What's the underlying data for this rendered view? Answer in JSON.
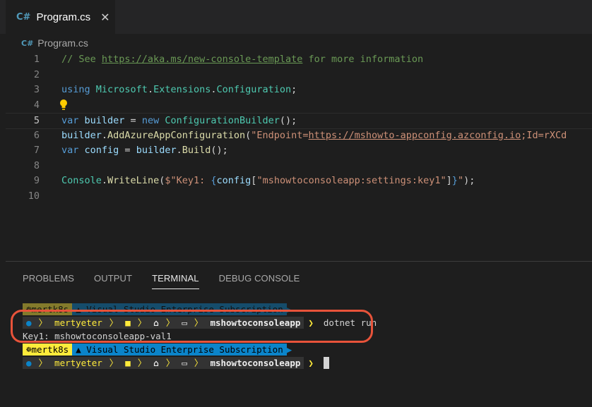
{
  "tab": {
    "icon": "csharp-file-icon",
    "label": "Program.cs",
    "close_icon": "close-icon"
  },
  "breadcrumb": {
    "label": "Program.cs"
  },
  "editor": {
    "lines": [
      {
        "num": "1",
        "segments": [
          {
            "t": "// See ",
            "c": "c-com"
          },
          {
            "t": "https://aka.ms/new-console-template",
            "c": "c-link"
          },
          {
            "t": " for more information",
            "c": "c-com"
          }
        ]
      },
      {
        "num": "2",
        "segments": []
      },
      {
        "num": "3",
        "segments": [
          {
            "t": "using ",
            "c": "c-kw"
          },
          {
            "t": "Microsoft",
            "c": "c-type"
          },
          {
            "t": ".",
            "c": "c-punct"
          },
          {
            "t": "Extensions",
            "c": "c-type"
          },
          {
            "t": ".",
            "c": "c-punct"
          },
          {
            "t": "Configuration",
            "c": "c-type"
          },
          {
            "t": ";",
            "c": "c-punct"
          }
        ]
      },
      {
        "num": "4",
        "segments": []
      },
      {
        "num": "5",
        "current": true,
        "segments": [
          {
            "t": "var ",
            "c": "c-kw"
          },
          {
            "t": "builder",
            "c": "c-var"
          },
          {
            "t": " = ",
            "c": "c-txt"
          },
          {
            "t": "new ",
            "c": "c-kw"
          },
          {
            "t": "ConfigurationBuilder",
            "c": "c-type"
          },
          {
            "t": "();",
            "c": "c-punct"
          }
        ]
      },
      {
        "num": "6",
        "segments": [
          {
            "t": "builder",
            "c": "c-var"
          },
          {
            "t": ".",
            "c": "c-punct"
          },
          {
            "t": "AddAzureAppConfiguration",
            "c": "c-fn"
          },
          {
            "t": "(",
            "c": "c-punct"
          },
          {
            "t": "\"Endpoint=",
            "c": "c-str"
          },
          {
            "t": "https://mshowto-appconfig.azconfig.io",
            "c": "c-strlink"
          },
          {
            "t": ";Id=rXCd",
            "c": "c-str"
          }
        ]
      },
      {
        "num": "7",
        "segments": [
          {
            "t": "var ",
            "c": "c-kw"
          },
          {
            "t": "config",
            "c": "c-var"
          },
          {
            "t": " = ",
            "c": "c-txt"
          },
          {
            "t": "builder",
            "c": "c-var"
          },
          {
            "t": ".",
            "c": "c-punct"
          },
          {
            "t": "Build",
            "c": "c-fn"
          },
          {
            "t": "();",
            "c": "c-punct"
          }
        ]
      },
      {
        "num": "8",
        "segments": []
      },
      {
        "num": "9",
        "segments": [
          {
            "t": "Console",
            "c": "c-type"
          },
          {
            "t": ".",
            "c": "c-punct"
          },
          {
            "t": "WriteLine",
            "c": "c-fn"
          },
          {
            "t": "(",
            "c": "c-punct"
          },
          {
            "t": "$\"Key1: ",
            "c": "c-str"
          },
          {
            "t": "{",
            "c": "c-brace"
          },
          {
            "t": "config",
            "c": "c-var"
          },
          {
            "t": "[",
            "c": "c-punct"
          },
          {
            "t": "\"mshowtoconsoleapp:settings:key1\"",
            "c": "c-str"
          },
          {
            "t": "]",
            "c": "c-punct"
          },
          {
            "t": "}",
            "c": "c-brace"
          },
          {
            "t": "\"",
            "c": "c-str"
          },
          {
            "t": ");",
            "c": "c-punct"
          }
        ]
      },
      {
        "num": "10",
        "segments": []
      }
    ],
    "lightbulb_icon": "lightbulb-icon"
  },
  "panel": {
    "tabs": [
      {
        "label": "PROBLEMS",
        "active": false
      },
      {
        "label": "OUTPUT",
        "active": false
      },
      {
        "label": "TERMINAL",
        "active": true
      },
      {
        "label": "DEBUG CONSOLE",
        "active": false
      }
    ]
  },
  "terminal": {
    "k8s_icon": "helm-wheel-icon",
    "k8s_context": "mertk8s",
    "azure_icon": "azure-icon",
    "azure_subscription": "Visual Studio Enterprise Subscription",
    "apple_icon": "apple-icon",
    "user": "mertyeter",
    "folder_icon": "folder-icon",
    "home_icon": "home-icon",
    "folder_open_icon": "folder-open-icon",
    "directory": "mshowtoconsoleapp",
    "command": "dotnet run",
    "output": "Key1: mshowtoconsoleapp-val1"
  },
  "annotation": {
    "color": "#e8533a"
  }
}
